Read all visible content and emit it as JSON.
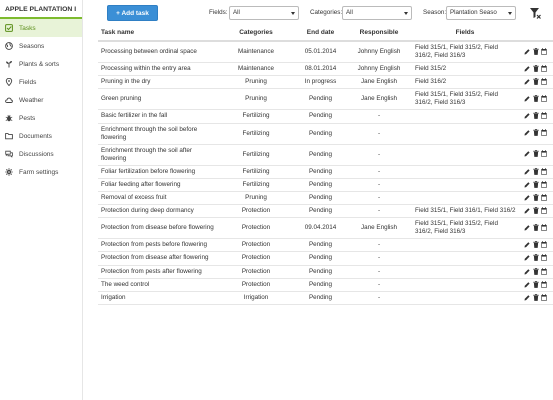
{
  "app": {
    "title": "APPLE PLANTATION I"
  },
  "sidebar": {
    "items": [
      {
        "label": "Tasks",
        "icon": "check-square-icon",
        "active": true
      },
      {
        "label": "Seasons",
        "icon": "globe-icon",
        "active": false
      },
      {
        "label": "Plants & sorts",
        "icon": "plant-icon",
        "active": false
      },
      {
        "label": "Fields",
        "icon": "map-marker-icon",
        "active": false
      },
      {
        "label": "Weather",
        "icon": "cloud-icon",
        "active": false
      },
      {
        "label": "Pests",
        "icon": "bug-icon",
        "active": false
      },
      {
        "label": "Documents",
        "icon": "folder-icon",
        "active": false
      },
      {
        "label": "Discussions",
        "icon": "comments-icon",
        "active": false
      },
      {
        "label": "Farm settings",
        "icon": "gear-icon",
        "active": false
      }
    ]
  },
  "toolbar": {
    "add_label": "+ Add task",
    "fields_label": "Fields:",
    "fields_value": "All",
    "categories_label": "Categories:",
    "categories_value": "All",
    "season_label": "Season:",
    "season_value": "Plantation Seaso"
  },
  "table": {
    "headers": {
      "task": "Task name",
      "category": "Categories",
      "end_date": "End date",
      "responsible": "Responsible",
      "fields": "Fields"
    },
    "rows": [
      {
        "task": "Processing between ordinal space",
        "category": "Maintenance",
        "date": "05.01.2014",
        "date_status": "red",
        "responsible": "Johnny English",
        "fields": "Field 315/1, Field 315/2, Field 316/2, Field 316/3"
      },
      {
        "task": "Processing within the entry area",
        "category": "Maintenance",
        "date": "08.01.2014",
        "date_status": "red",
        "responsible": "Johnny English",
        "fields": "Field 315/2"
      },
      {
        "task": "Pruning in the dry",
        "category": "Pruning",
        "date": "In progress",
        "date_status": "red",
        "responsible": "Jane English",
        "fields": "Field 316/2"
      },
      {
        "task": "Green pruning",
        "category": "Pruning",
        "date": "Pending",
        "date_status": "pending",
        "responsible": "Jane English",
        "fields": "Field 315/1, Field 315/2, Field 316/2, Field 316/3"
      },
      {
        "task": "Basic fertilizer in the fall",
        "category": "Fertilizing",
        "date": "Pending",
        "date_status": "pending",
        "responsible": "-",
        "fields": ""
      },
      {
        "task": "Enrichment through the soil before flowering",
        "category": "Fertilizing",
        "date": "Pending",
        "date_status": "pending",
        "responsible": "-",
        "fields": ""
      },
      {
        "task": "Enrichment through the soil after flowering",
        "category": "Fertilizing",
        "date": "Pending",
        "date_status": "pending",
        "responsible": "-",
        "fields": ""
      },
      {
        "task": "Foliar fertilization before flowering",
        "category": "Fertilizing",
        "date": "Pending",
        "date_status": "pending",
        "responsible": "-",
        "fields": ""
      },
      {
        "task": "Foliar feeding after flowering",
        "category": "Fertilizing",
        "date": "Pending",
        "date_status": "pending",
        "responsible": "-",
        "fields": ""
      },
      {
        "task": "Removal of excess fruit",
        "category": "Pruning",
        "date": "Pending",
        "date_status": "pending",
        "responsible": "-",
        "fields": ""
      },
      {
        "task": "Protection during deep dormancy",
        "category": "Protection",
        "date": "Pending",
        "date_status": "pending",
        "responsible": "-",
        "fields": "Field 315/1, Field 316/1, Field 316/2"
      },
      {
        "task": "Protection from disease before flowering",
        "category": "Protection",
        "date": "09.04.2014",
        "date_status": "red",
        "responsible": "Jane English",
        "fields": "Field 315/1, Field 315/2, Field 316/2, Field 316/3"
      },
      {
        "task": "Protection from pests before flowering",
        "category": "Protection",
        "date": "Pending",
        "date_status": "pending",
        "responsible": "-",
        "fields": ""
      },
      {
        "task": "Protection from disease after flowering",
        "category": "Protection",
        "date": "Pending",
        "date_status": "pending",
        "responsible": "-",
        "fields": ""
      },
      {
        "task": "Protection from pests after flowering",
        "category": "Protection",
        "date": "Pending",
        "date_status": "pending",
        "responsible": "-",
        "fields": ""
      },
      {
        "task": "The weed control",
        "category": "Protection",
        "date": "Pending",
        "date_status": "pending",
        "responsible": "-",
        "fields": ""
      },
      {
        "task": "Irrigation",
        "category": "Irrigation",
        "date": "Pending",
        "date_status": "pending",
        "responsible": "-",
        "fields": ""
      }
    ]
  },
  "colors": {
    "accent": "#3b8fd6",
    "active_nav_bg": "#e8f3d8",
    "active_nav_text": "#5b8f1a",
    "overdue": "#e8403a",
    "pending": "#8cc8e8",
    "brand_underline": "#7dbb2e"
  }
}
